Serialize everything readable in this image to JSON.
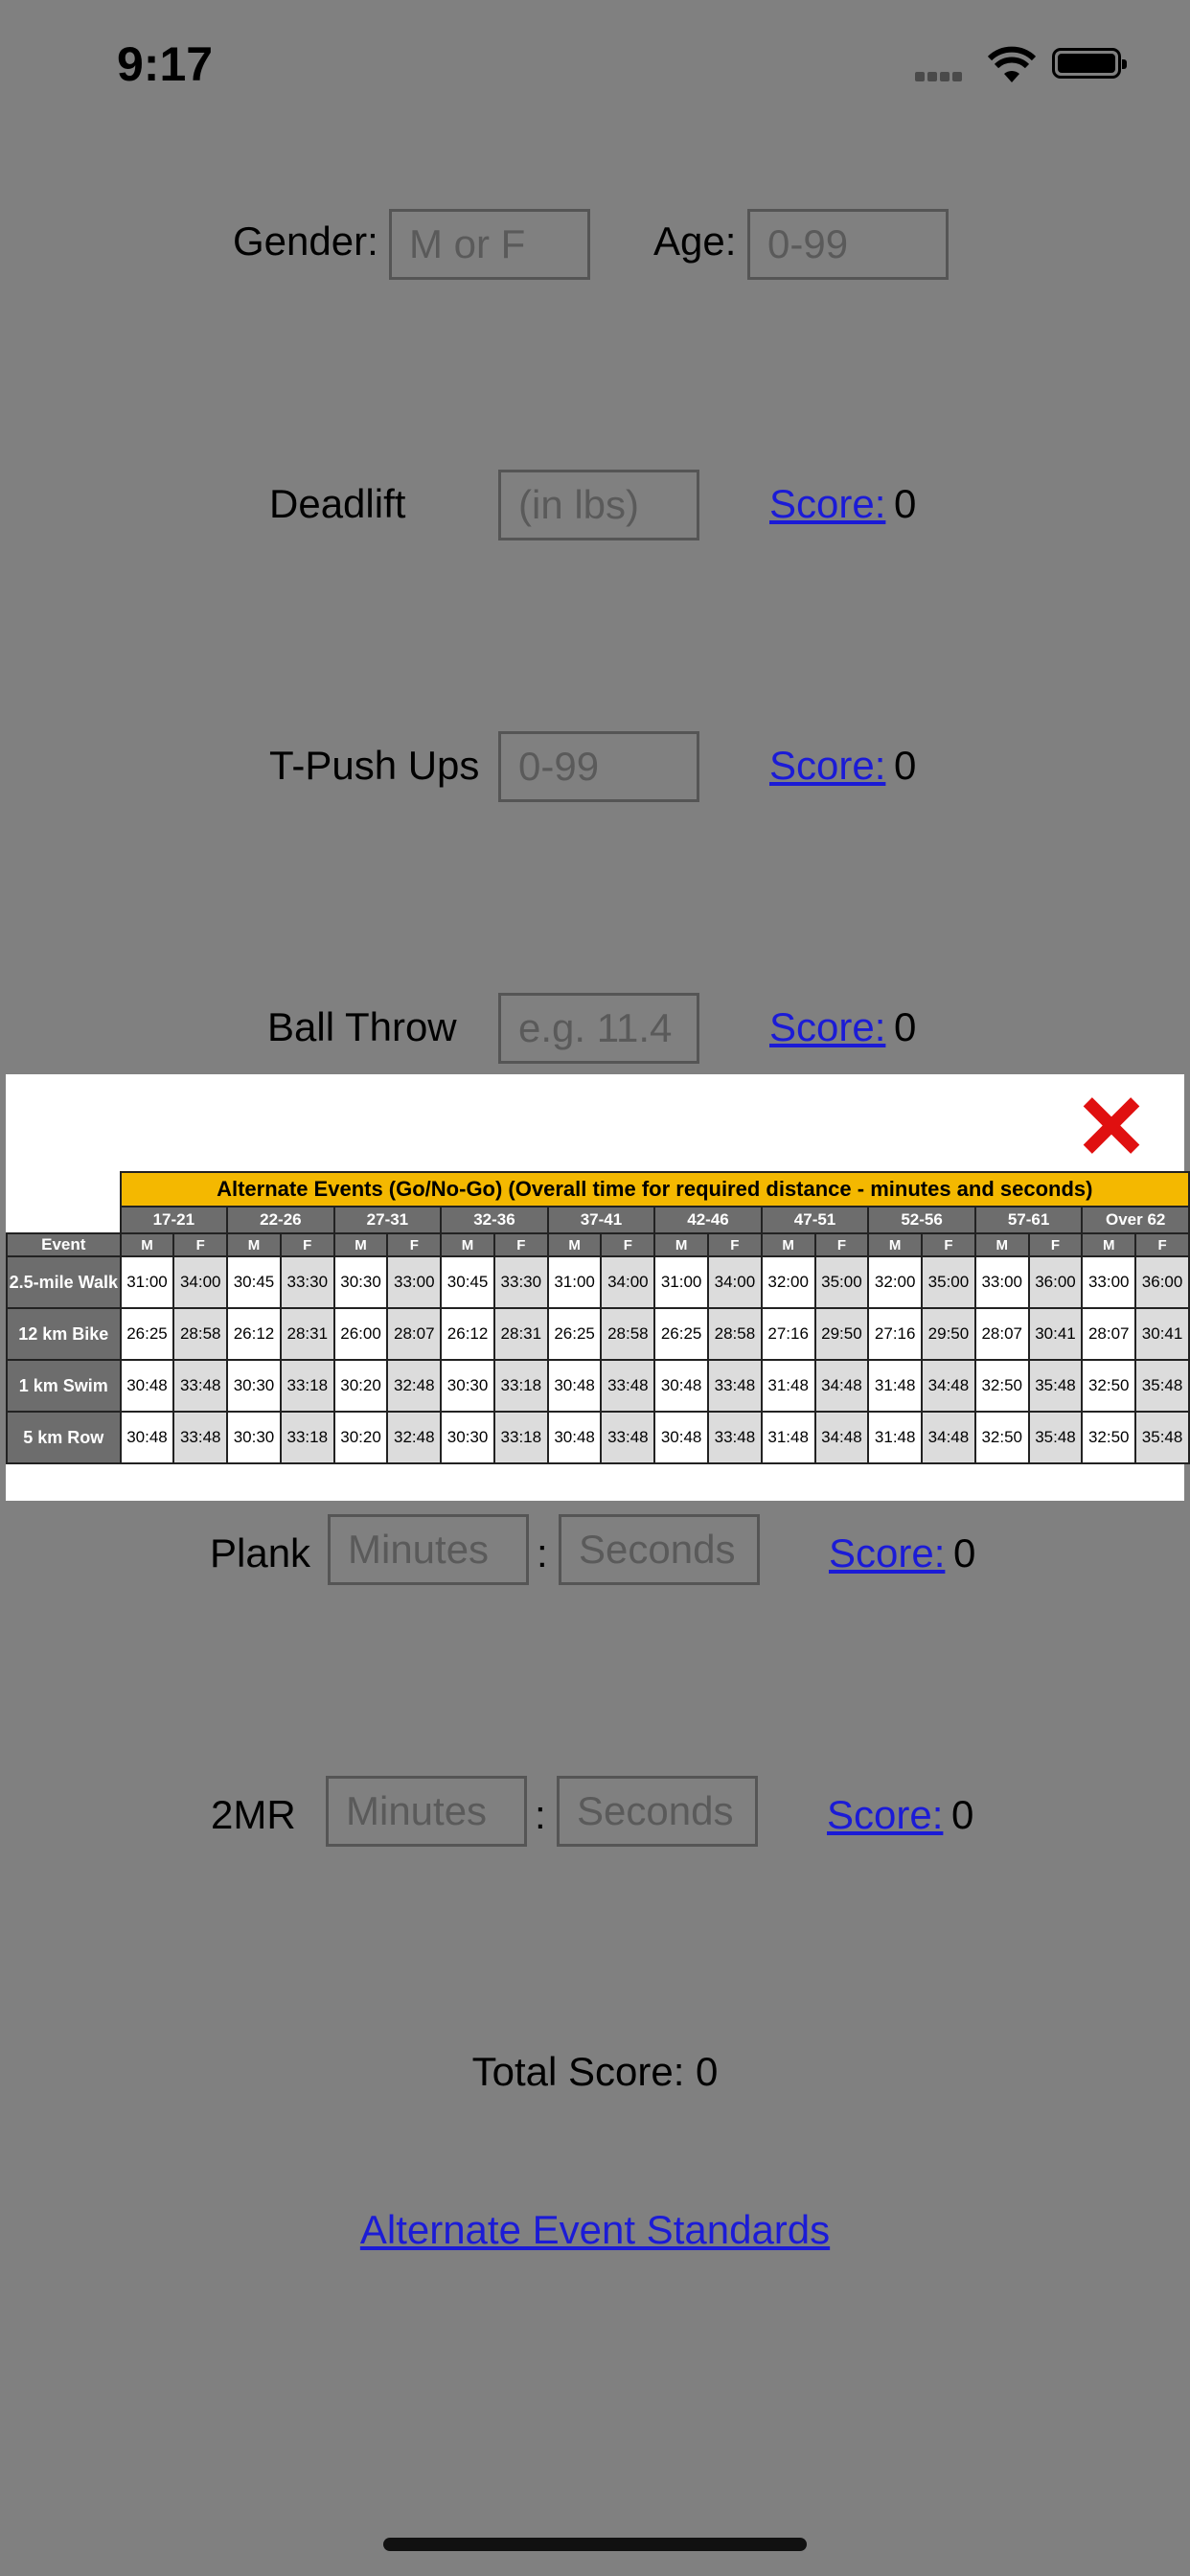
{
  "status": {
    "time": "9:17"
  },
  "form": {
    "gender_label": "Gender:",
    "gender_placeholder": "M or F",
    "age_label": "Age:",
    "age_placeholder": "0-99",
    "deadlift_label": "Deadlift",
    "deadlift_placeholder": "(in lbs)",
    "pushups_label": "T-Push Ups",
    "pushups_placeholder": "0-99",
    "ballthrow_label": "Ball Throw",
    "ballthrow_placeholder": "e.g. 11.4",
    "plank_label": "Plank",
    "twomr_label": "2MR",
    "minutes_placeholder": "Minutes",
    "seconds_placeholder": "Seconds",
    "colon": ":",
    "score_link": "Score:",
    "score_value": "0",
    "total_score": "Total Score: 0",
    "alt_link": "Alternate Event Standards"
  },
  "modal": {
    "close_label": "close",
    "table": {
      "title": "Alternate Events (Go/No-Go) (Overall time for required distance  -  minutes and seconds)",
      "event_header": "Event",
      "age_groups": [
        "17-21",
        "22-26",
        "27-31",
        "32-36",
        "37-41",
        "42-46",
        "47-51",
        "52-56",
        "57-61",
        "Over 62"
      ],
      "sex_labels": [
        "M",
        "F"
      ],
      "rows": [
        {
          "event": "2.5-mile Walk",
          "values": [
            "31:00",
            "34:00",
            "30:45",
            "33:30",
            "30:30",
            "33:00",
            "30:45",
            "33:30",
            "31:00",
            "34:00",
            "31:00",
            "34:00",
            "32:00",
            "35:00",
            "32:00",
            "35:00",
            "33:00",
            "36:00",
            "33:00",
            "36:00"
          ]
        },
        {
          "event": "12 km Bike",
          "values": [
            "26:25",
            "28:58",
            "26:12",
            "28:31",
            "26:00",
            "28:07",
            "26:12",
            "28:31",
            "26:25",
            "28:58",
            "26:25",
            "28:58",
            "27:16",
            "29:50",
            "27:16",
            "29:50",
            "28:07",
            "30:41",
            "28:07",
            "30:41"
          ]
        },
        {
          "event": "1 km Swim",
          "values": [
            "30:48",
            "33:48",
            "30:30",
            "33:18",
            "30:20",
            "32:48",
            "30:30",
            "33:18",
            "30:48",
            "33:48",
            "30:48",
            "33:48",
            "31:48",
            "34:48",
            "31:48",
            "34:48",
            "32:50",
            "35:48",
            "32:50",
            "35:48"
          ]
        },
        {
          "event": "5 km Row",
          "values": [
            "30:48",
            "33:48",
            "30:30",
            "33:18",
            "30:20",
            "32:48",
            "30:30",
            "33:18",
            "30:48",
            "33:48",
            "30:48",
            "33:48",
            "31:48",
            "34:48",
            "31:48",
            "34:48",
            "32:50",
            "35:48",
            "32:50",
            "35:48"
          ]
        }
      ]
    }
  }
}
